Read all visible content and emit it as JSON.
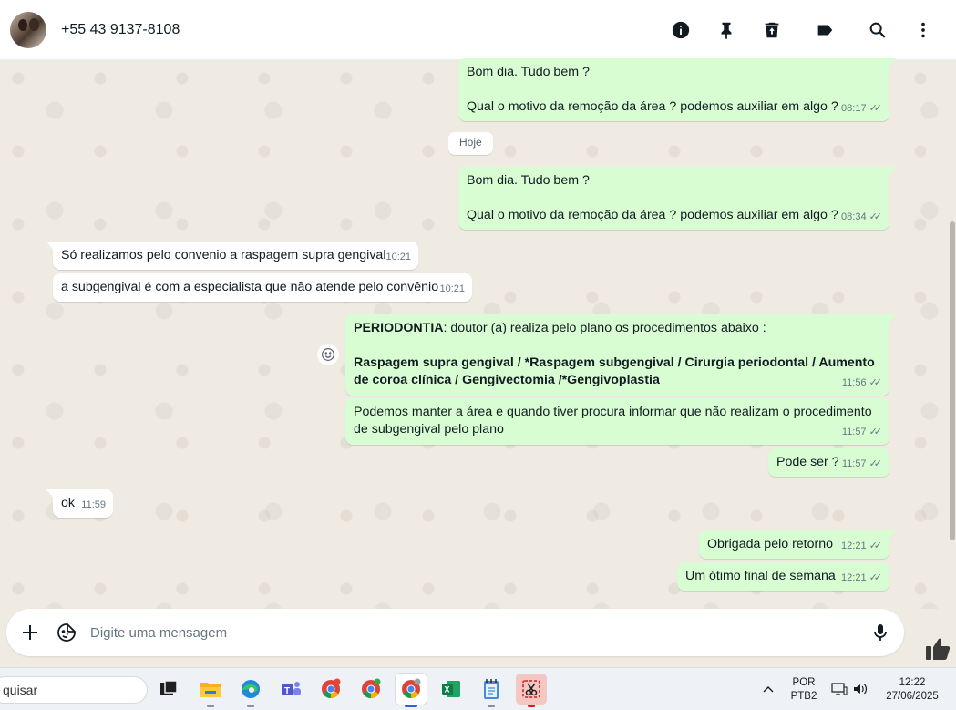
{
  "header": {
    "contact_name": "+55 43 9137-8108",
    "icons": [
      "info-icon",
      "pin-icon",
      "delete-icon",
      "label-icon",
      "search-icon",
      "more-icon"
    ]
  },
  "date_divider": "Hoje",
  "messages": [
    {
      "direction": "out",
      "lines": [
        "Bom dia. Tudo bem ?",
        "",
        "Qual o motivo da remoção da área ? podemos auxiliar em algo ?"
      ],
      "time": "08:17",
      "status": "read"
    },
    {
      "direction": "out",
      "lines": [
        "Bom dia. Tudo bem ?",
        "",
        "Qual o motivo da remoção da área ? podemos auxiliar em algo ?"
      ],
      "time": "08:34",
      "status": "read"
    },
    {
      "direction": "in",
      "lines": [
        "Só realizamos pelo convenio a raspagem supra gengival"
      ],
      "time": "10:21"
    },
    {
      "direction": "in",
      "lines": [
        "a subgengival é com a especialista que não atende pelo convênio"
      ],
      "time": "10:21"
    },
    {
      "direction": "out",
      "heading": "PERIODONTIA",
      "heading_rest": ": doutor (a) realiza pelo plano os procedimentos abaixo :",
      "bold_lines": [
        "Raspagem supra gengival / *Raspagem subgengival / Cirurgia periodontal / Aumento",
        "de coroa clínica / Gengivectomia /*Gengivoplastia"
      ],
      "time": "11:56",
      "status": "read"
    },
    {
      "direction": "out",
      "lines": [
        "Podemos manter a área e quando tiver procura informar que não realizam o procedimento",
        "de subgengival pelo plano"
      ],
      "time": "11:57",
      "status": "read"
    },
    {
      "direction": "out",
      "lines": [
        "Pode ser ?"
      ],
      "time": "11:57",
      "status": "read"
    },
    {
      "direction": "in",
      "lines": [
        "ok"
      ],
      "time": "11:59"
    },
    {
      "direction": "out",
      "lines": [
        "Obrigada pelo retorno"
      ],
      "time": "12:21",
      "status": "read"
    },
    {
      "direction": "out",
      "lines": [
        "Um ótimo final de semana"
      ],
      "time": "12:21",
      "status": "read"
    }
  ],
  "composer": {
    "placeholder": "Digite uma mensagem",
    "value": ""
  },
  "taskbar": {
    "search_text": "quisar",
    "apps": [
      "task-view",
      "file-explorer",
      "edge",
      "teams",
      "chrome",
      "chrome",
      "chrome-active",
      "excel",
      "notepad",
      "snipping-tool"
    ],
    "language": "POR",
    "layout": "PTB2",
    "time": "12:22",
    "date": "27/06/2025"
  },
  "colors": {
    "outgoing_bubble": "#d9fdd3",
    "incoming_bubble": "#ffffff",
    "chat_background": "#efeae2",
    "read_ticks": "#667781"
  }
}
